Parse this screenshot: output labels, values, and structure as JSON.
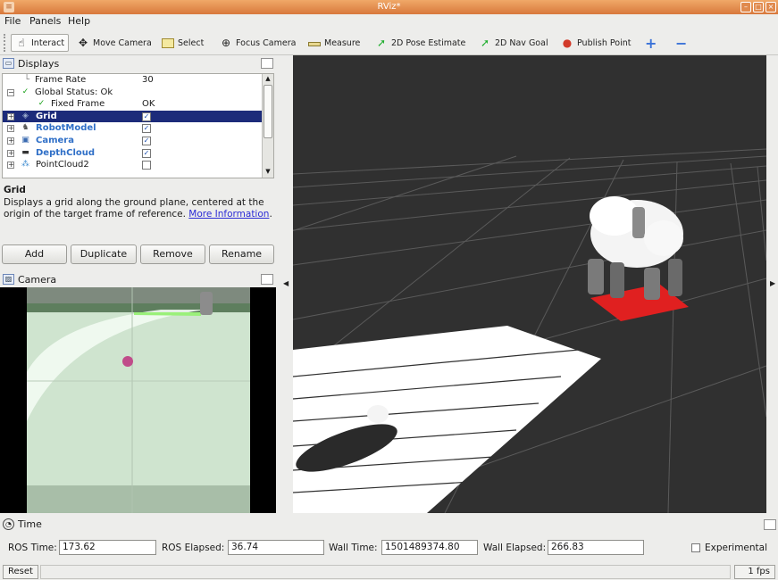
{
  "window": {
    "title": "RViz*"
  },
  "menu": [
    {
      "label": "File"
    },
    {
      "label": "Panels"
    },
    {
      "label": "Help"
    }
  ],
  "toolbar": {
    "tools": [
      {
        "label": "Interact",
        "icon": "hand-icon",
        "active": true
      },
      {
        "label": "Move Camera",
        "icon": "move-camera-icon"
      },
      {
        "label": "Select",
        "icon": "select-icon"
      },
      {
        "label": "Focus Camera",
        "icon": "focus-camera-icon"
      },
      {
        "label": "Measure",
        "icon": "ruler-icon"
      },
      {
        "label": "2D Pose Estimate",
        "icon": "green-arrow-icon"
      },
      {
        "label": "2D Nav Goal",
        "icon": "green-arrow-icon"
      },
      {
        "label": "Publish Point",
        "icon": "map-pin-icon"
      }
    ]
  },
  "displays": {
    "title": "Displays",
    "rows": [
      {
        "name": "Frame Rate",
        "value": "30"
      },
      {
        "name": "Global Status: Ok"
      },
      {
        "name": "Fixed Frame",
        "value": "OK"
      },
      {
        "name": "Grid",
        "checked": true,
        "selected": true
      },
      {
        "name": "RobotModel",
        "checked": true
      },
      {
        "name": "Camera",
        "checked": true
      },
      {
        "name": "DepthCloud",
        "checked": true
      },
      {
        "name": "PointCloud2",
        "checked": false
      }
    ],
    "description": {
      "title": "Grid",
      "text": "Displays a grid along the ground plane, centered at the origin of the target frame of reference.",
      "link": "More Information"
    },
    "buttons": {
      "add": "Add",
      "duplicate": "Duplicate",
      "remove": "Remove",
      "rename": "Rename"
    }
  },
  "camera_panel": {
    "title": "Camera"
  },
  "time_panel": {
    "title": "Time",
    "ros_time_label": "ROS Time:",
    "ros_time": "173.62",
    "ros_elapsed_label": "ROS Elapsed:",
    "ros_elapsed": "36.74",
    "wall_time_label": "Wall Time:",
    "wall_time": "1501489374.80",
    "wall_elapsed_label": "Wall Elapsed:",
    "wall_elapsed": "266.83",
    "experimental_label": "Experimental"
  },
  "statusbar": {
    "reset_label": "Reset",
    "fps": "1 fps"
  },
  "colors": {
    "title_bar": "#d8783c",
    "selection": "#1c2b7a",
    "view_bg": "#303030",
    "link": "#2b2bd6"
  }
}
